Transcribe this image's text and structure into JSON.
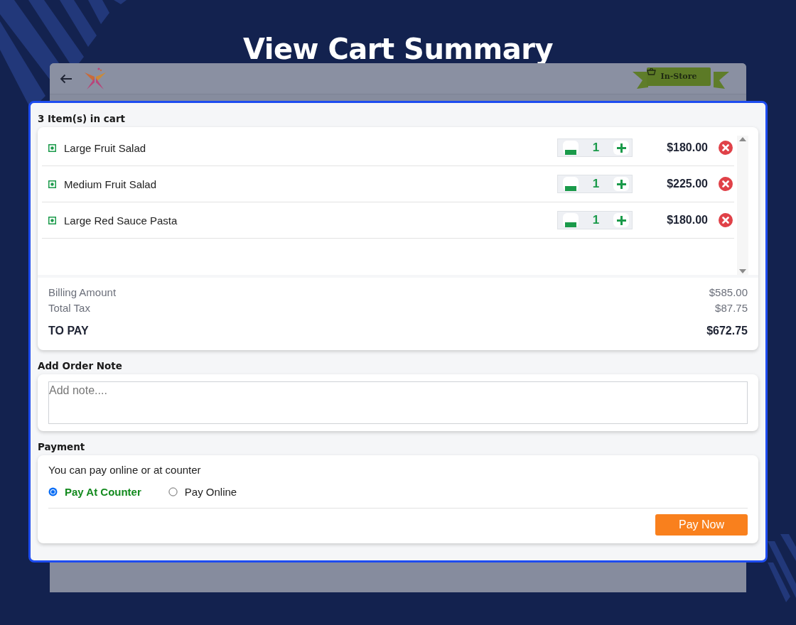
{
  "page_title": "View Cart Summary",
  "app_header": {
    "badge": "In-Store"
  },
  "cart": {
    "heading": "3 Item(s) in cart",
    "items": [
      {
        "name": "Large Fruit Salad",
        "quantity": "1",
        "price": "$180.00"
      },
      {
        "name": "Medium Fruit Salad",
        "quantity": "1",
        "price": "$225.00"
      },
      {
        "name": "Large Red Sauce Pasta",
        "quantity": "1",
        "price": "$180.00"
      }
    ]
  },
  "summary": {
    "rows": [
      {
        "kind": "line",
        "label": "Billing Amount",
        "value": "$585.00"
      },
      {
        "kind": "line",
        "label": "Total Tax",
        "value": "$87.75"
      },
      {
        "kind": "total",
        "label": "TO PAY",
        "value": "$672.75"
      }
    ]
  },
  "note": {
    "heading": "Add Order Note",
    "placeholder": "Add note...."
  },
  "payment": {
    "heading": "Payment",
    "hint": "You can pay online or at counter",
    "options": [
      {
        "label": "Pay At Counter",
        "selected": true
      },
      {
        "label": "Pay Online",
        "selected": false
      }
    ],
    "button": "Pay Now"
  }
}
